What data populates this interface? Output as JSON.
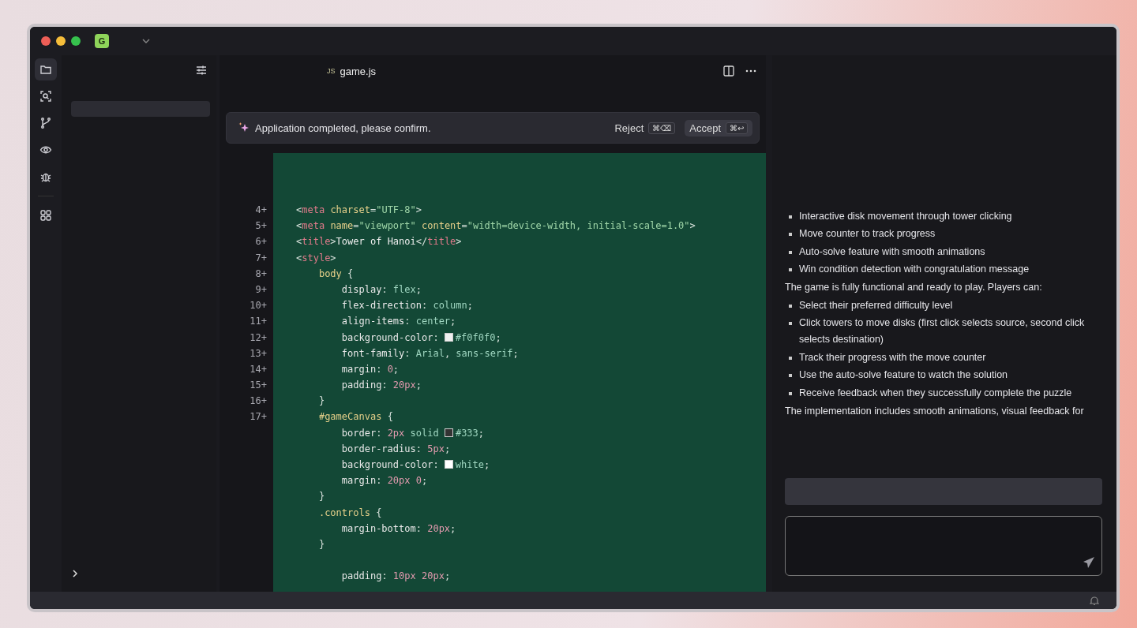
{
  "titlebar": {
    "project_badge": "G"
  },
  "activity_bar": [
    {
      "selected": true
    },
    {
      "selected": false
    },
    {
      "selected": false
    },
    {
      "selected": false
    },
    {
      "selected": false
    },
    {
      "selected": false
    }
  ],
  "editor": {
    "tab": {
      "lang": "JS",
      "name": "game.js"
    },
    "banner": {
      "message": "Application completed, please confirm.",
      "reject": {
        "label": "Reject",
        "shortcut": "⌘⌫"
      },
      "accept": {
        "label": "Accept",
        "shortcut": "⌘↩"
      }
    },
    "lines": [
      {
        "no": "4+",
        "code": "<meta charset=\"UTF-8\">"
      },
      {
        "no": "5+",
        "code": "<meta name=\"viewport\" content=\"width=device-width, initial-scale=1.0\">"
      },
      {
        "no": "6+",
        "code": "<title>Tower of Hanoi</title>"
      },
      {
        "no": "7+",
        "code": "<style>"
      },
      {
        "no": "8+",
        "code": "    body {"
      },
      {
        "no": "9+",
        "code": "        display: flex;"
      },
      {
        "no": "10+",
        "code": "        flex-direction: column;"
      },
      {
        "no": "11+",
        "code": "        align-items: center;"
      },
      {
        "no": "12+",
        "code": "        background-color: #f0f0f0;",
        "color": "#f0f0f0"
      },
      {
        "no": "13+",
        "code": "        font-family: Arial, sans-serif;"
      },
      {
        "no": "14+",
        "code": "        margin: 0;"
      },
      {
        "no": "15+",
        "code": "        padding: 20px;"
      },
      {
        "no": "16+",
        "code": "    }"
      },
      {
        "no": "17+",
        "code": "    #gameCanvas {"
      },
      {
        "code": "        border: 2px solid #333;",
        "color": "#333333"
      },
      {
        "code": "        border-radius: 5px;"
      },
      {
        "code": "        background-color: white;",
        "color": "#ffffff"
      },
      {
        "code": "        margin: 20px 0;"
      },
      {
        "code": "    }"
      },
      {
        "code": "    .controls {"
      },
      {
        "code": "        margin-bottom: 20px;"
      },
      {
        "code": "    }"
      },
      {
        "code": "        padding: 10px 20px;"
      }
    ]
  },
  "chat": {
    "blocks": [
      {
        "kind": "bullet",
        "text": "Interactive disk movement through tower clicking"
      },
      {
        "kind": "bullet",
        "text": "Move counter to track progress"
      },
      {
        "kind": "bullet",
        "text": "Auto-solve feature with smooth animations"
      },
      {
        "kind": "bullet",
        "text": "Win condition detection with congratulation message"
      },
      {
        "kind": "para",
        "text": "The game is fully functional and ready to play. Players can:"
      },
      {
        "kind": "bullet",
        "text": "Select their preferred difficulty level"
      },
      {
        "kind": "bullet",
        "text": "Click towers to move disks (first click selects source, second click selects destination)"
      },
      {
        "kind": "bullet",
        "text": "Track their progress with the move counter"
      },
      {
        "kind": "bullet",
        "text": "Use the auto-solve feature to watch the solution"
      },
      {
        "kind": "bullet",
        "text": "Receive feedback when they successfully complete the puzzle"
      },
      {
        "kind": "para",
        "text": "The implementation includes smooth animations, visual feedback for"
      }
    ]
  }
}
